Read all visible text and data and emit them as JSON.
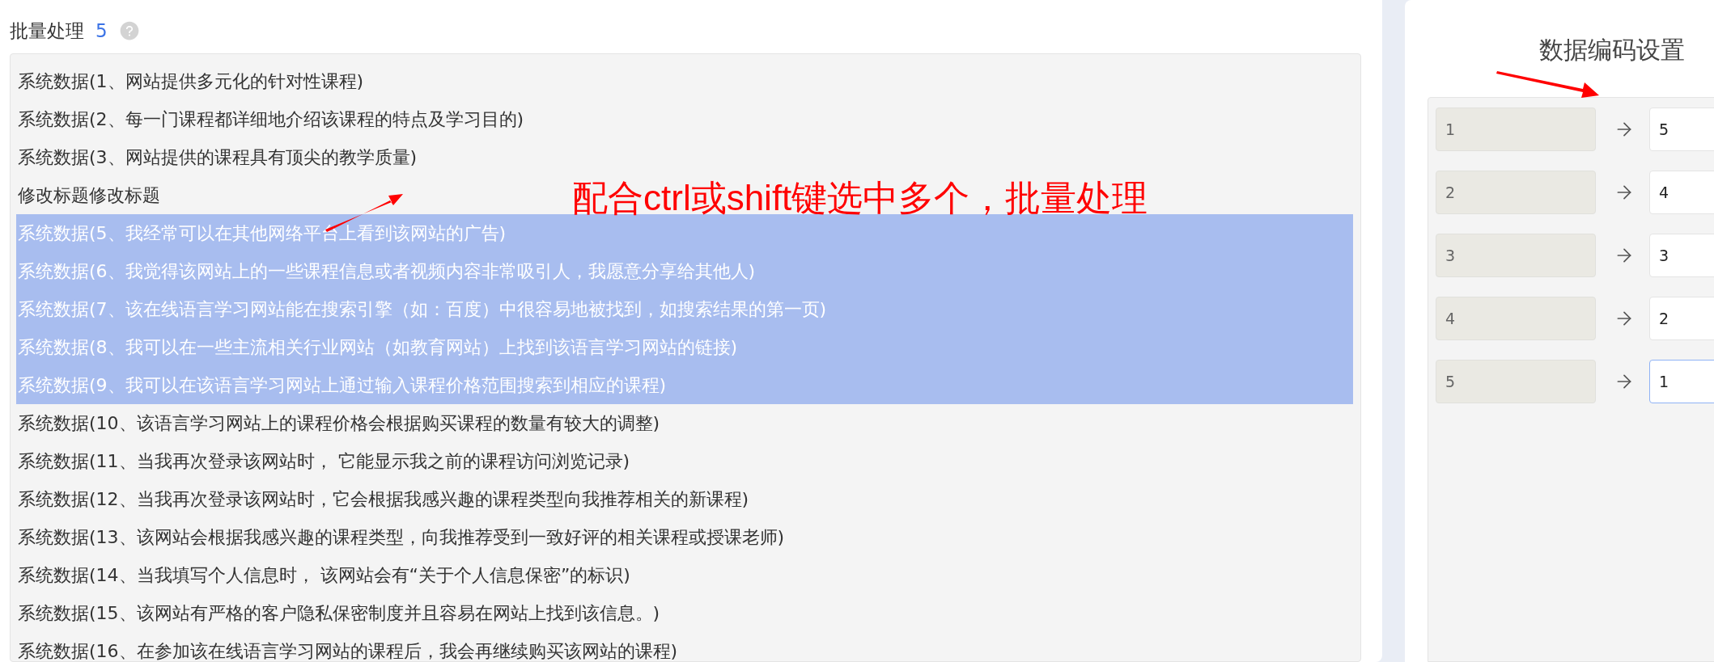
{
  "batch": {
    "title": "批量处理",
    "count": "5",
    "items": [
      {
        "text": "系统数据(1、网站提供多元化的针对性课程)",
        "selected": false
      },
      {
        "text": "系统数据(2、每一门课程都详细地介绍该课程的特点及学习目的)",
        "selected": false
      },
      {
        "text": "系统数据(3、网站提供的课程具有顶尖的教学质量)",
        "selected": false
      },
      {
        "text": "修改标题修改标题",
        "selected": false
      },
      {
        "text": "系统数据(5、我经常可以在其他网络平台上看到该网站的广告)",
        "selected": true
      },
      {
        "text": "系统数据(6、我觉得该网站上的一些课程信息或者视频内容非常吸引人，我愿意分享给其他人)",
        "selected": true
      },
      {
        "text": "系统数据(7、该在线语言学习网站能在搜索引擎（如：百度）中很容易地被找到，如搜索结果的第一页)",
        "selected": true
      },
      {
        "text": "系统数据(8、我可以在一些主流相关行业网站（如教育网站）上找到该语言学习网站的链接)",
        "selected": true
      },
      {
        "text": "系统数据(9、我可以在该语言学习网站上通过输入课程价格范围搜索到相应的课程)",
        "selected": true
      },
      {
        "text": "系统数据(10、该语言学习网站上的课程价格会根据购买课程的数量有较大的调整)",
        "selected": false
      },
      {
        "text": "系统数据(11、当我再次登录该网站时， 它能显示我之前的课程访问浏览记录)",
        "selected": false
      },
      {
        "text": "系统数据(12、当我再次登录该网站时，它会根据我感兴趣的课程类型向我推荐相关的新课程)",
        "selected": false
      },
      {
        "text": "系统数据(13、该网站会根据我感兴趣的课程类型，向我推荐受到一致好评的相关课程或授课老师)",
        "selected": false
      },
      {
        "text": "系统数据(14、当我填写个人信息时， 该网站会有“关于个人信息保密”的标识)",
        "selected": false
      },
      {
        "text": "系统数据(15、该网站有严格的客户隐私保密制度并且容易在网站上找到该信息。)",
        "selected": false
      },
      {
        "text": "系统数据(16、在参加该在线语言学习网站的课程后，我会再继续购买该网站的课程)",
        "selected": false
      }
    ]
  },
  "annotation": {
    "text": "配合ctrl或shift键选中多个，批量处理"
  },
  "encoding": {
    "title": "数据编码设置",
    "rows": [
      {
        "source": "1",
        "target": "5",
        "focused": false
      },
      {
        "source": "2",
        "target": "4",
        "focused": false
      },
      {
        "source": "3",
        "target": "3",
        "focused": false
      },
      {
        "source": "4",
        "target": "2",
        "focused": false
      },
      {
        "source": "5",
        "target": "1",
        "focused": true
      }
    ]
  }
}
